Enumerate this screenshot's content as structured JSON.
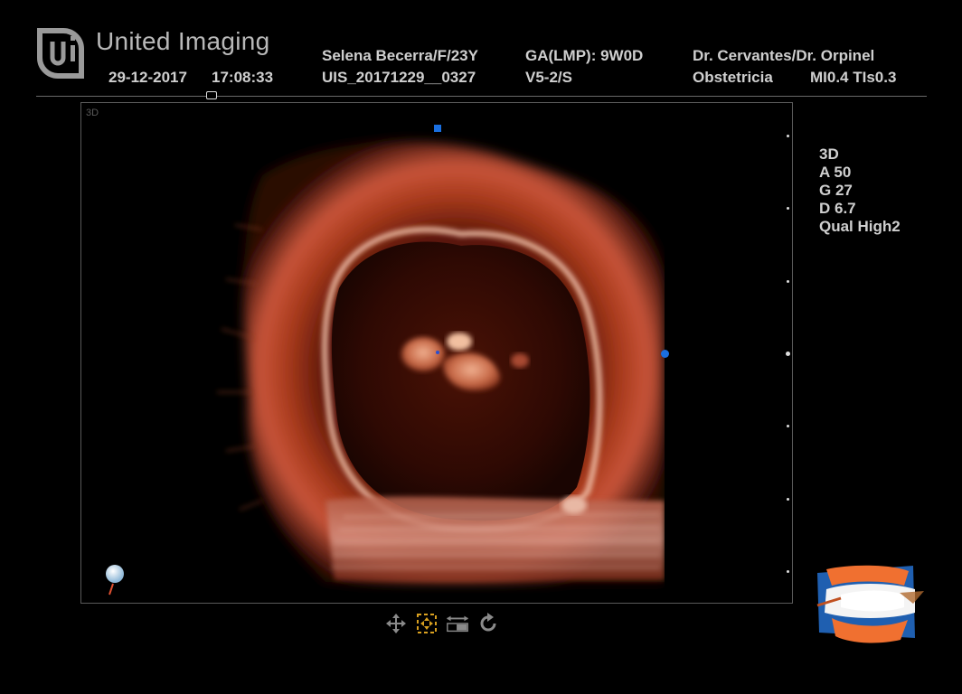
{
  "header": {
    "brand": "United Imaging",
    "date": "29-12-2017",
    "time": "17:08:33",
    "patient": "Selena Becerra/F/23Y",
    "study_id": "UIS_20171229__0327",
    "gestational_age": "GA(LMP): 9W0D",
    "probe": "V5-2/S",
    "physicians": "Dr. Cervantes/Dr. Orpinel",
    "department": "Obstetricia",
    "indices": "MI0.4 TIs0.3"
  },
  "viewport": {
    "mode_tag": "3D"
  },
  "params": {
    "mode": "3D",
    "a": "A 50",
    "g": "G 27",
    "d": "D 6.7",
    "qual": "Qual High2"
  },
  "toolbar": {
    "tools": [
      "move-icon",
      "crop-icon",
      "scale-icon",
      "rotate-icon"
    ]
  },
  "colors": {
    "tissue_dark": "#3a0c05",
    "tissue_mid": "#8a2a14",
    "tissue_bright": "#f0c0a8",
    "marker_blue": "#1a6fe0",
    "cube_blue": "#1f5fb0",
    "cube_orange": "#f07030"
  }
}
